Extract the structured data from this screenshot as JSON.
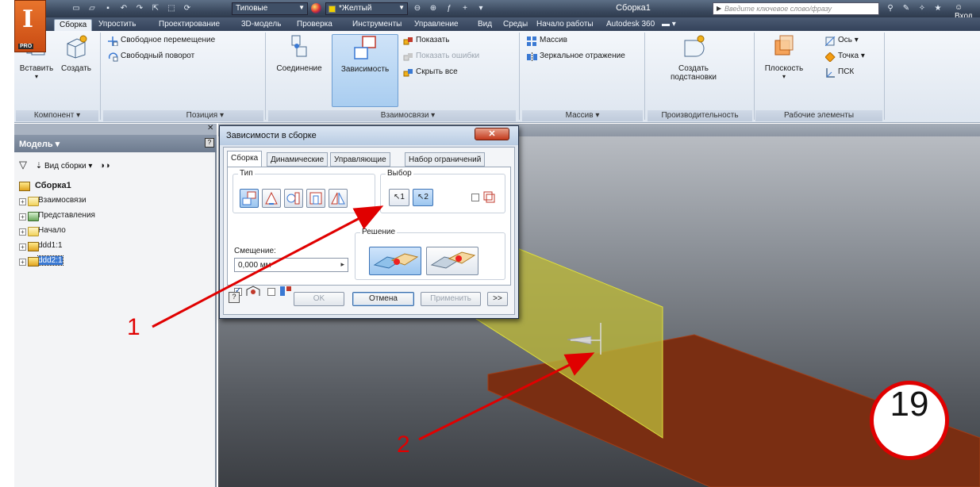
{
  "titlebar": {
    "preset": "Типовые",
    "color_style": "*Желтый",
    "doc_title": "Сборка1",
    "search_placeholder": "Введите ключевое слово/фразу",
    "signin": "Вход"
  },
  "logo": {
    "text": "I",
    "edition": "PRO"
  },
  "tabs": [
    {
      "label": "Сборка",
      "active": true
    },
    {
      "label": "Упростить"
    },
    {
      "label": "Проектирование"
    },
    {
      "label": "3D-модель"
    },
    {
      "label": "Проверка"
    },
    {
      "label": "Инструменты"
    },
    {
      "label": "Управление"
    },
    {
      "label": "Вид"
    },
    {
      "label": "Среды"
    },
    {
      "label": "Начало работы"
    },
    {
      "label": "Autodesk 360"
    }
  ],
  "ribbon": {
    "component": {
      "title": "Компонент ▾",
      "insert": "Вставить",
      "create": "Создать"
    },
    "position": {
      "title": "Позиция ▾",
      "free_move": "Свободное перемещение",
      "free_rotate": "Свободный поворот"
    },
    "relationships": {
      "title": "Взаимосвязи ▾",
      "joint": "Соединение",
      "constraint": "Зависимость",
      "show": "Показать",
      "show_errors": "Показать ошибки",
      "hide_all": "Скрыть все"
    },
    "pattern": {
      "title": "Массив ▾",
      "pattern": "Массив",
      "mirror": "Зеркальное отражение"
    },
    "productivity": {
      "title": "Производительность",
      "create_sub_line1": "Создать",
      "create_sub_line2": "подстановки"
    },
    "work_features": {
      "title": "Рабочие элементы",
      "plane": "Плоскость",
      "axis": "Ось ▾",
      "point": "Точка ▾",
      "ucs": "ПСК"
    }
  },
  "browser": {
    "title": "Модель ▾",
    "view": "Вид сборки",
    "tree": [
      {
        "label": "Сборка1",
        "root": true
      },
      {
        "label": "Взаимосвязи"
      },
      {
        "label": "Представления"
      },
      {
        "label": "Начало"
      },
      {
        "label": "ddd1:1"
      },
      {
        "label": "ddd2:1",
        "selected": true
      }
    ]
  },
  "dialog": {
    "title": "Зависимости в сборке",
    "tabs": [
      "Сборка",
      "Динамические",
      "Управляющие",
      "Набор ограничений"
    ],
    "type_label": "Тип",
    "selection_label": "Выбор",
    "select1": "1",
    "select2": "2",
    "offset_label": "Смещение:",
    "offset_value": "0,000 мм",
    "solution_label": "Решение",
    "ok": "OK",
    "cancel": "Отмена",
    "apply": "Применить",
    "more": ">>"
  },
  "annotations": {
    "label1": "1",
    "label2": "2",
    "step": "19"
  },
  "colors": {
    "accent": "#e00000",
    "ribbon_blue": "#3a79d3",
    "plane_yellow": "#d8d63a",
    "plane_red": "#8a2a10"
  }
}
